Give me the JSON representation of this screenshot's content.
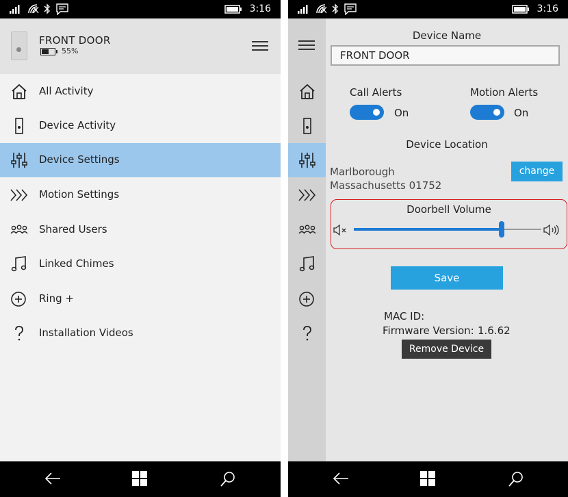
{
  "status_bar": {
    "time": "3:16"
  },
  "device": {
    "name": "FRONT DOOR",
    "battery": "55%"
  },
  "menu": [
    {
      "label": "All Activity",
      "icon": "home-icon"
    },
    {
      "label": "Device Activity",
      "icon": "doorbell-icon"
    },
    {
      "label": "Device Settings",
      "icon": "sliders-icon",
      "active": true
    },
    {
      "label": "Motion Settings",
      "icon": "chevrons-icon"
    },
    {
      "label": "Shared Users",
      "icon": "users-icon"
    },
    {
      "label": "Linked Chimes",
      "icon": "music-note-icon"
    },
    {
      "label": "Ring +",
      "icon": "plus-circle-icon"
    },
    {
      "label": "Installation Videos",
      "icon": "question-icon"
    }
  ],
  "settings": {
    "device_name_label": "Device Name",
    "device_name_value": "FRONT DOOR",
    "call_alerts": {
      "label": "Call Alerts",
      "state": "On"
    },
    "motion_alerts": {
      "label": "Motion Alerts",
      "state": "On"
    },
    "location_label": "Device Location",
    "location_line1": "Marlborough",
    "location_line2": "Massachusetts 01752",
    "change_label": "change",
    "volume_label": "Doorbell Volume",
    "volume_level": 0.79,
    "save_label": "Save",
    "mac_label": "MAC ID:",
    "firmware_label": "Firmware Version:",
    "firmware_value": "1.6.62",
    "remove_label": "Remove Device"
  },
  "colors": {
    "accent": "#1e7bd3",
    "selected_row": "#9cc7ec",
    "button": "#27a2df",
    "highlight_box": "#d91f1f"
  }
}
